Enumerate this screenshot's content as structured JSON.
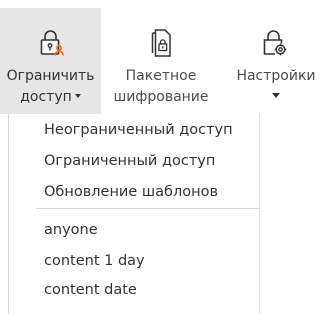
{
  "ribbon": {
    "restrict_access": {
      "line1": "Ограничить",
      "line2": "доступ",
      "icon": "lock-user-icon"
    },
    "batch_encryption": {
      "line1": "Пакетное",
      "line2": "шифрование",
      "icon": "documents-lock-icon"
    },
    "settings": {
      "line1": "Настройки",
      "icon": "lock-gear-icon"
    }
  },
  "menu": {
    "items": [
      "Неограниченный доступ",
      "Ограниченный доступ",
      "Обновление шаблонов"
    ],
    "templates": [
      "anyone",
      "content 1 day",
      "content date"
    ]
  },
  "colors": {
    "active_bg": "#e6e6e6",
    "accent_orange": "#ff6a00",
    "icon_gray": "#333333",
    "text": "#333333"
  }
}
